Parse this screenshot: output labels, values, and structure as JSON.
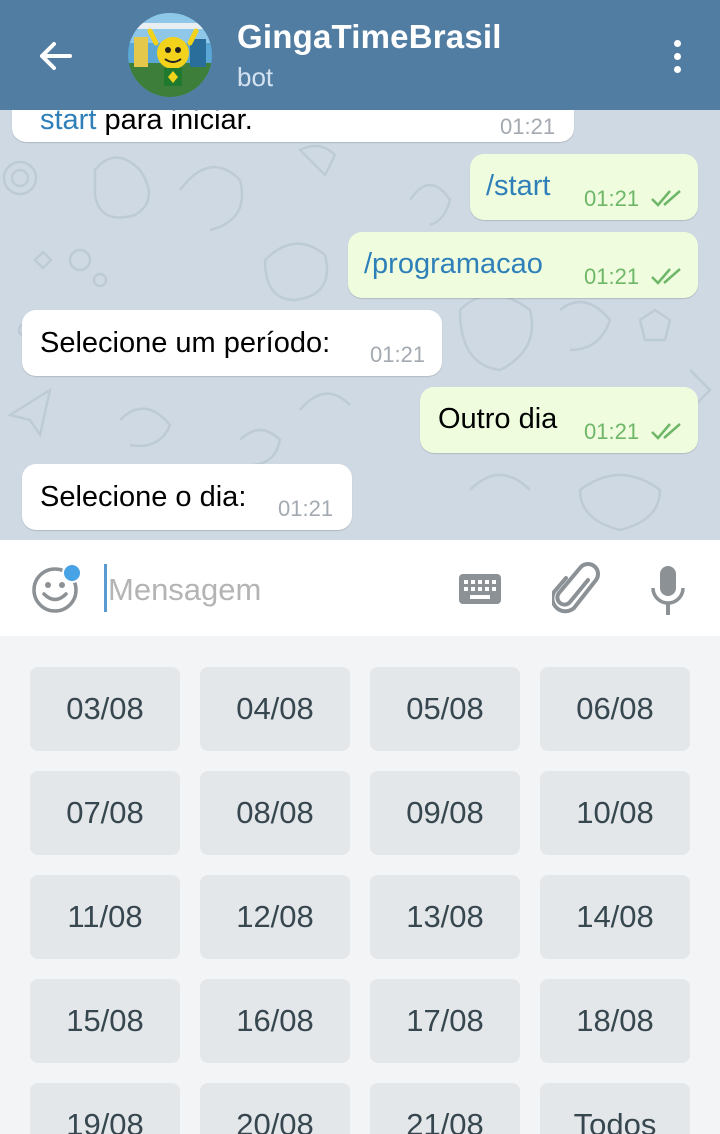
{
  "header": {
    "title": "GingaTimeBrasil",
    "subtitle": "bot"
  },
  "messages": [
    {
      "dir": "in",
      "text_link": "start",
      "text_rest": " para iniciar.",
      "time": "01:21"
    },
    {
      "dir": "out",
      "text": "/start",
      "time": "01:21",
      "status": "read"
    },
    {
      "dir": "out",
      "text": "/programacao",
      "time": "01:21",
      "status": "read"
    },
    {
      "dir": "in",
      "text": "Selecione um período:",
      "time": "01:21"
    },
    {
      "dir": "out",
      "text": "Outro dia",
      "time": "01:21",
      "status": "read"
    },
    {
      "dir": "in",
      "text": "Selecione o dia:",
      "time": "01:21"
    }
  ],
  "input": {
    "placeholder": "Mensagem"
  },
  "keyboard": {
    "rows": [
      [
        "03/08",
        "04/08",
        "05/08",
        "06/08"
      ],
      [
        "07/08",
        "08/08",
        "09/08",
        "10/08"
      ],
      [
        "11/08",
        "12/08",
        "13/08",
        "14/08"
      ],
      [
        "15/08",
        "16/08",
        "17/08",
        "18/08"
      ],
      [
        "19/08",
        "20/08",
        "21/08",
        "Todos"
      ]
    ]
  },
  "icons": {
    "back": "arrow-left-icon",
    "menu": "more-vertical-icon",
    "emoji": "smiley-icon",
    "keyboard": "keyboard-icon",
    "attach": "paperclip-icon",
    "mic": "microphone-icon"
  },
  "colors": {
    "header": "#527da3",
    "outgoing_bubble": "#effdde",
    "incoming_bubble": "#ffffff",
    "key_background": "#e4e7e9",
    "link": "#2f80b8"
  }
}
